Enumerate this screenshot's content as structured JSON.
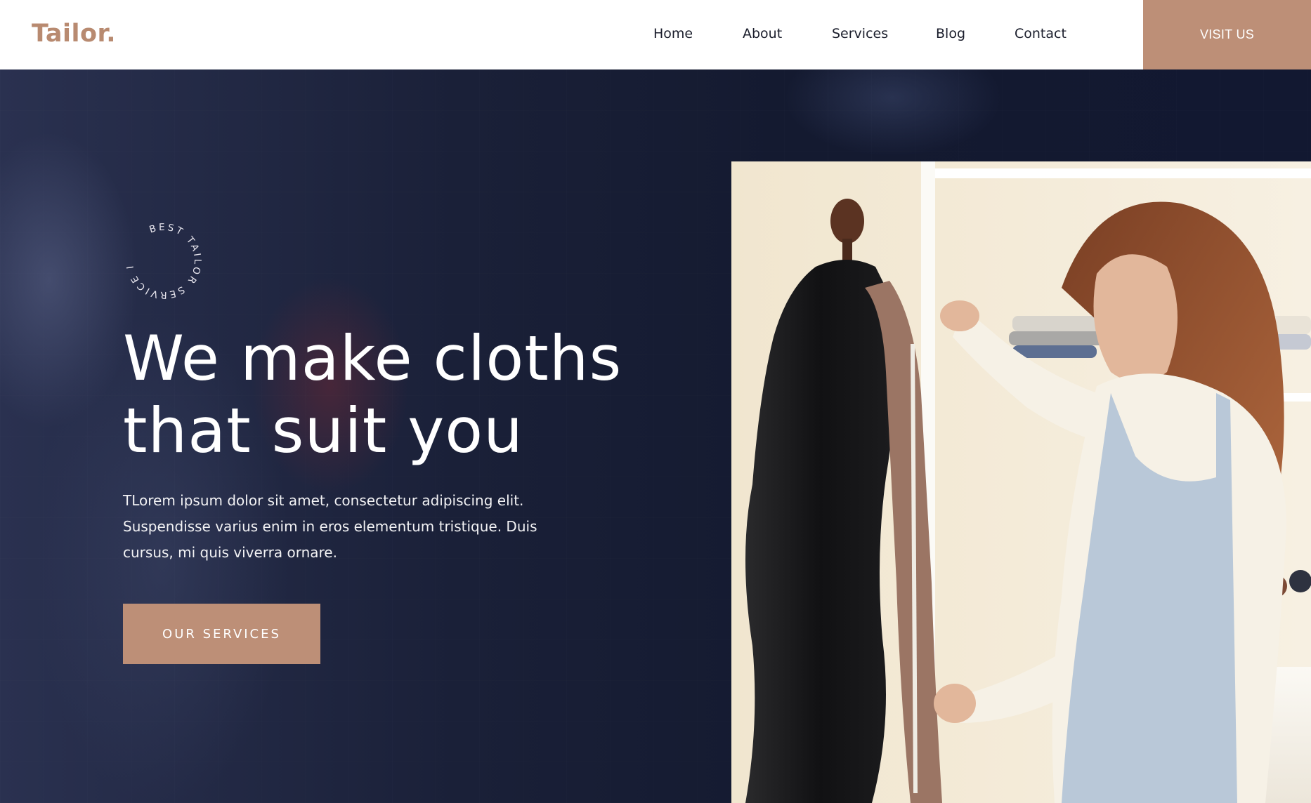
{
  "header": {
    "logo": "Tailor.",
    "nav": [
      "Home",
      "About",
      "Services",
      "Blog",
      "Contact"
    ],
    "cta_label": "VISIT US"
  },
  "hero": {
    "badge_text": "BEST TAILOR SERVICE IN YOUR CITY",
    "headline_lines": [
      "We make cloths",
      "that suit you"
    ],
    "description_lines": [
      "TLorem ipsum dolor sit amet, consectetur adipiscing elit.",
      "Suspendisse varius enim in eros elementum tristique. Duis",
      "cursus, mi quis viverra ornare."
    ],
    "button_label": "OUR SERVICES"
  },
  "colors": {
    "accent": "#bd8f77",
    "logo": "#b88a70",
    "hero_bg": "#151b32",
    "nav_text": "#1b1e2c"
  }
}
